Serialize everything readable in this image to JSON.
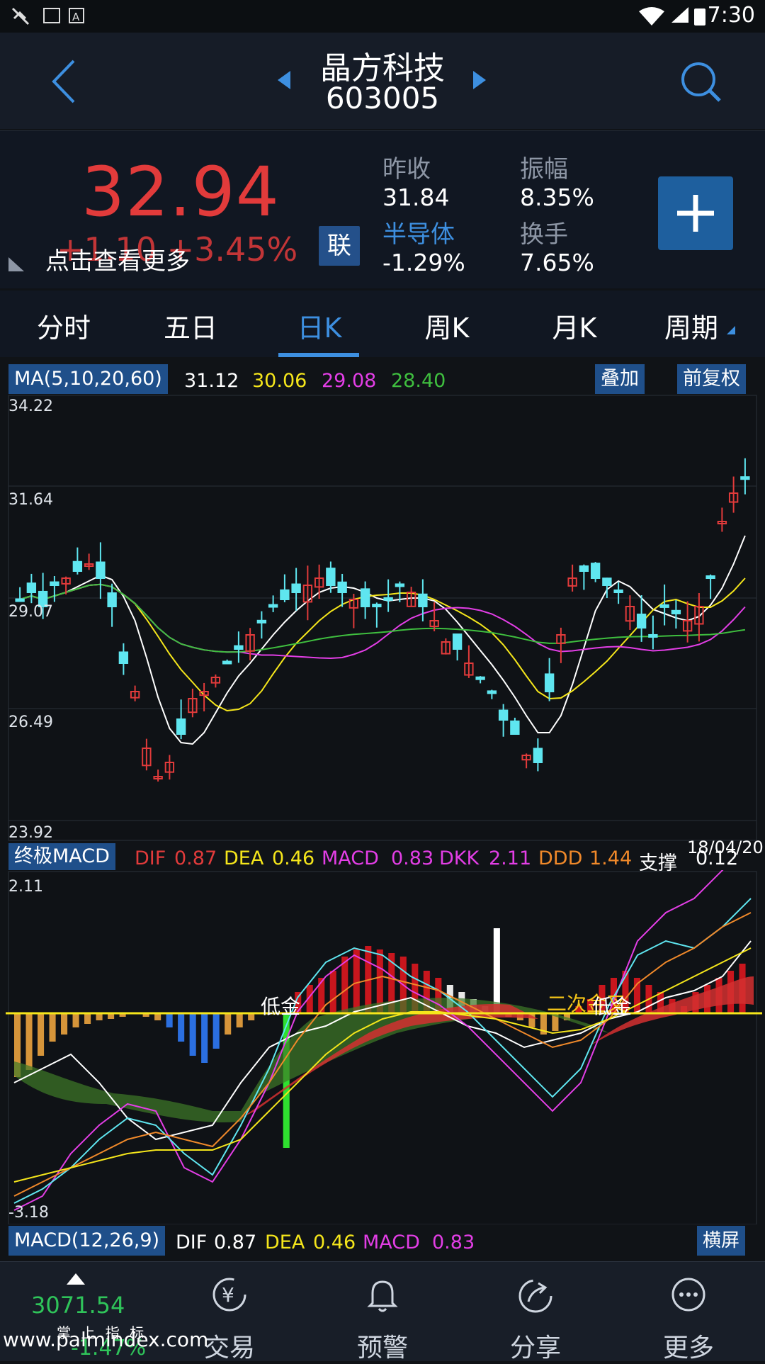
{
  "status_bar": {
    "time": "7:30"
  },
  "header": {
    "title": "晶方科技",
    "code": "603005"
  },
  "quote": {
    "price": "32.94",
    "change": "+1.10 +3.45%",
    "more_hint": "点击查看更多",
    "badge": "联",
    "prev_close_label": "昨收",
    "prev_close": "31.84",
    "amplitude_label": "振幅",
    "amplitude": "8.35%",
    "sector_label": "半导体",
    "sector_change": "-1.29%",
    "turnover_label": "换手",
    "turnover": "7.65%",
    "colors": {
      "up": "#e23b3b",
      "sector": "#3d8fe0"
    }
  },
  "tabs": [
    {
      "label": "分时",
      "active": false
    },
    {
      "label": "五日",
      "active": false
    },
    {
      "label": "日K",
      "active": true
    },
    {
      "label": "周K",
      "active": false
    },
    {
      "label": "月K",
      "active": false
    },
    {
      "label": "周期",
      "active": false
    }
  ],
  "ma_row": {
    "label": "MA(5,10,20,60)",
    "values": [
      "31.12",
      "30.06",
      "29.08",
      "28.40"
    ],
    "overlay_button": "叠加",
    "adjust_button": "前复权"
  },
  "candle_chart": {
    "y_labels": [
      "34.22",
      "31.64",
      "29.07",
      "26.49",
      "23.92"
    ],
    "date": "18/04/20"
  },
  "macd_row": {
    "label": "终极MACD",
    "items": [
      {
        "name": "DIF",
        "value": "0.87"
      },
      {
        "name": "DEA",
        "value": "0.46"
      },
      {
        "name": "MACD",
        "value": "0.83"
      },
      {
        "name": "DKK",
        "value": "2.11"
      },
      {
        "name": "DDD",
        "value": "1.44"
      },
      {
        "name": "支撑",
        "value": "0.12"
      }
    ]
  },
  "macd_chart": {
    "y_labels": [
      "2.11",
      "-3.18"
    ],
    "annotations": [
      "低金",
      "二次金叉",
      "低金"
    ]
  },
  "macd_label_row": {
    "label": "MACD(12,26,9)",
    "dif_label": "DIF",
    "dif": "0.87",
    "dea_label": "DEA",
    "dea": "0.46",
    "macd_label": "MACD",
    "macd": "0.83",
    "landscape_button": "横屏"
  },
  "bottom_nav": {
    "index_value": "3071.54",
    "index_change": "-1.47%",
    "brand": "掌 上 指 标",
    "items": [
      {
        "label": "交易",
        "icon": "yen-icon"
      },
      {
        "label": "预警",
        "icon": "bell-icon"
      },
      {
        "label": "分享",
        "icon": "share-icon"
      },
      {
        "label": "更多",
        "icon": "more-icon"
      }
    ]
  },
  "watermark": "www.palmindex.com"
}
